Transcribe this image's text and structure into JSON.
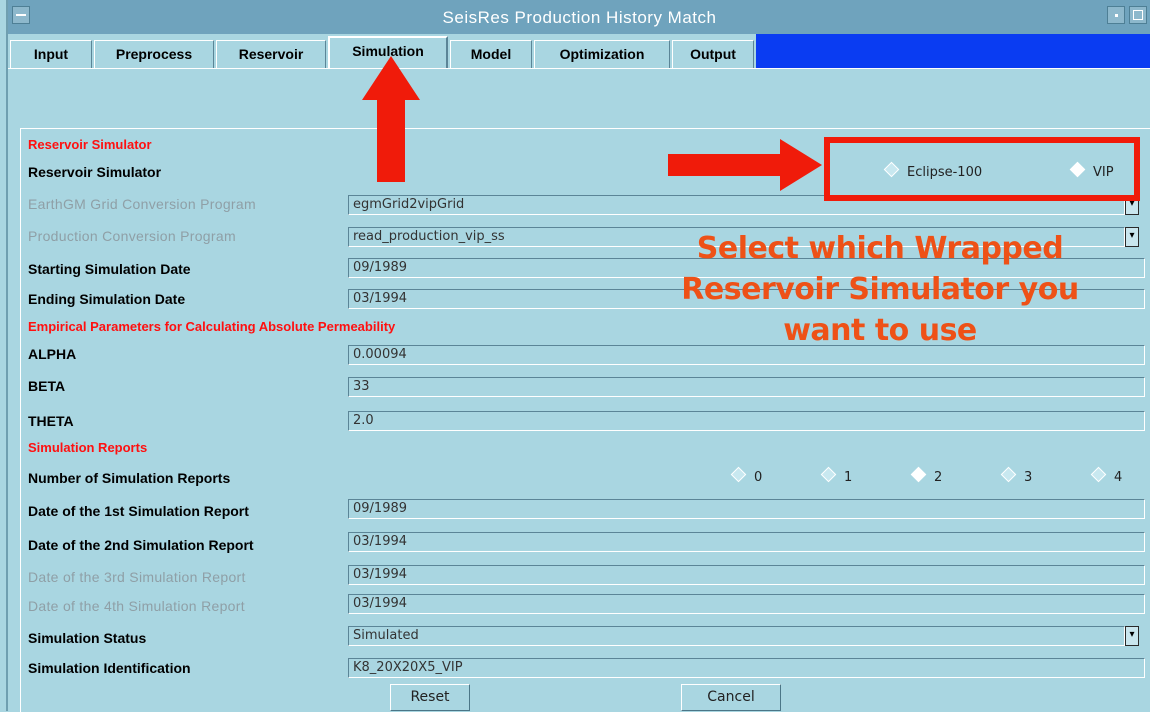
{
  "window": {
    "title": "SeisRes Production History Match"
  },
  "tabs": [
    {
      "label": "Input"
    },
    {
      "label": "Preprocess"
    },
    {
      "label": "Reservoir"
    },
    {
      "label": "Simulation",
      "active": true
    },
    {
      "label": "Model"
    },
    {
      "label": "Optimization"
    },
    {
      "label": "Output"
    }
  ],
  "sections": {
    "reservoir_simulator": "Reservoir Simulator",
    "empirical": "Empirical Parameters for Calculating Absolute Permeability",
    "reports": "Simulation Reports"
  },
  "simulator": {
    "label": "Reservoir Simulator",
    "options": [
      {
        "label": "Eclipse-100",
        "selected": false
      },
      {
        "label": "VIP",
        "selected": true
      }
    ]
  },
  "fields": {
    "grid_conv": {
      "label": "EarthGM Grid Conversion Program",
      "value": "egmGrid2vipGrid"
    },
    "prod_conv": {
      "label": "Production Conversion Program",
      "value": "read_production_vip_ss"
    },
    "start_date": {
      "label": "Starting Simulation Date",
      "value": "09/1989"
    },
    "end_date": {
      "label": "Ending Simulation Date",
      "value": "03/1994"
    },
    "alpha": {
      "label": "ALPHA",
      "value": "0.00094"
    },
    "beta": {
      "label": "BETA",
      "value": "33"
    },
    "theta": {
      "label": "THETA",
      "value": "2.0"
    },
    "report1": {
      "label": "Date of the 1st Simulation Report",
      "value": "09/1989"
    },
    "report2": {
      "label": "Date of the 2nd Simulation Report",
      "value": "03/1994"
    },
    "report3": {
      "label": "Date of the 3rd Simulation Report",
      "value": "03/1994"
    },
    "report4": {
      "label": "Date of the 4th Simulation Report",
      "value": "03/1994"
    },
    "status": {
      "label": "Simulation Status",
      "value": "Simulated"
    },
    "sim_id": {
      "label": "Simulation Identification",
      "value": "K8_20X20X5_VIP"
    }
  },
  "num_reports": {
    "label": "Number of Simulation Reports",
    "options": [
      {
        "label": "0",
        "selected": false
      },
      {
        "label": "1",
        "selected": false
      },
      {
        "label": "2",
        "selected": true
      },
      {
        "label": "3",
        "selected": false
      },
      {
        "label": "4",
        "selected": false
      }
    ]
  },
  "buttons": {
    "reset": "Reset",
    "cancel": "Cancel"
  },
  "annotation": {
    "line1": "Select which Wrapped",
    "line2": "Reservoir Simulator you",
    "line3": "want to use",
    "color": "#ee5117",
    "arrow_color": "#f01b0a"
  }
}
